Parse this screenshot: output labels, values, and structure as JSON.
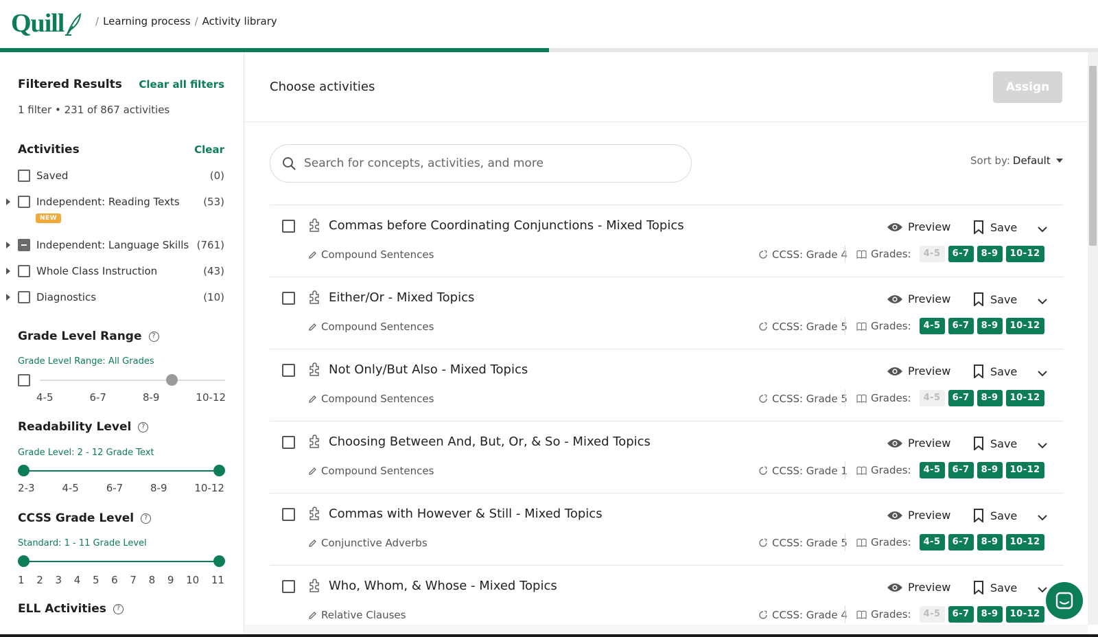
{
  "header": {
    "logo_text": "Quill",
    "breadcrumb": [
      "Learning process",
      "Activity library"
    ],
    "progress_fraction": 0.5
  },
  "sidebar": {
    "filtered_title": "Filtered Results",
    "clear_all": "Clear all filters",
    "filter_summary": "1 filter • 231 of 867 activities",
    "activities_title": "Activities",
    "activities_clear": "Clear",
    "items": [
      {
        "label": "Saved",
        "count": "(0)",
        "state": "unchecked",
        "expandable": false
      },
      {
        "label": "Independent: Reading Texts",
        "count": "(53)",
        "state": "unchecked",
        "expandable": true,
        "badge": "NEW"
      },
      {
        "label": "Independent: Language Skills",
        "count": "(761)",
        "state": "partial",
        "expandable": true
      },
      {
        "label": "Whole Class Instruction",
        "count": "(43)",
        "state": "unchecked",
        "expandable": true
      },
      {
        "label": "Diagnostics",
        "count": "(10)",
        "state": "unchecked",
        "expandable": true
      }
    ],
    "grade_range": {
      "title": "Grade Level Range",
      "caption": "Grade Level Range: All Grades",
      "ticks": [
        "4-5",
        "6-7",
        "8-9",
        "10-12"
      ],
      "thumb_position": "8-9"
    },
    "readability": {
      "title": "Readability Level",
      "caption": "Grade Level: 2 - 12 Grade Text",
      "ticks": [
        "2-3",
        "4-5",
        "6-7",
        "8-9",
        "10-12"
      ],
      "min": "2-3",
      "max": "10-12"
    },
    "ccss": {
      "title": "CCSS Grade Level",
      "caption": "Standard: 1 - 11 Grade Level",
      "ticks": [
        "1",
        "2",
        "3",
        "4",
        "5",
        "6",
        "7",
        "8",
        "9",
        "10",
        "11"
      ],
      "min": 1,
      "max": 11
    },
    "ell": {
      "title": "ELL Activities"
    }
  },
  "main": {
    "title": "Choose activities",
    "assign_label": "Assign",
    "search_placeholder": "Search for concepts, activities, and more",
    "sort_label": "Sort by:",
    "sort_value": "Default",
    "preview_label": "Preview",
    "save_label": "Save",
    "grades_label": "Grades:",
    "grade_names": [
      "4-5",
      "6-7",
      "8-9",
      "10-12"
    ],
    "activities": [
      {
        "title": "Commas before Coordinating Conjunctions - Mixed Topics",
        "concept": "Compound Sentences",
        "ccss": "CCSS: Grade 4",
        "grades": [
          false,
          true,
          true,
          true
        ]
      },
      {
        "title": "Either/Or - Mixed Topics",
        "concept": "Compound Sentences",
        "ccss": "CCSS: Grade 5",
        "grades": [
          true,
          true,
          true,
          true
        ]
      },
      {
        "title": "Not Only/But Also - Mixed Topics",
        "concept": "Compound Sentences",
        "ccss": "CCSS: Grade 5",
        "grades": [
          false,
          true,
          true,
          true
        ]
      },
      {
        "title": "Choosing Between And, But, Or, & So - Mixed Topics",
        "concept": "Compound Sentences",
        "ccss": "CCSS: Grade 1",
        "grades": [
          true,
          true,
          true,
          true
        ]
      },
      {
        "title": "Commas with However & Still - Mixed Topics",
        "concept": "Conjunctive Adverbs",
        "ccss": "CCSS: Grade 5",
        "grades": [
          true,
          true,
          true,
          true
        ]
      },
      {
        "title": "Who, Whom, & Whose - Mixed Topics",
        "concept": "Relative Clauses",
        "ccss": "CCSS: Grade 4",
        "grades": [
          false,
          true,
          true,
          true
        ]
      }
    ]
  },
  "colors": {
    "brand": "#0c7c59",
    "badge_new": "#f2a93b",
    "disabled": "#d6d6d6"
  }
}
